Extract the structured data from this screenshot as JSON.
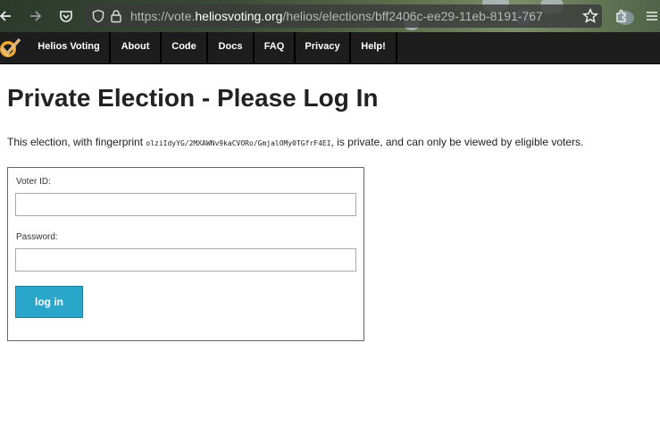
{
  "browser": {
    "url_scheme": "https://vote.",
    "url_domain": "heliosvoting.org",
    "url_path": "/helios/elections/bff2406c-ee29-11eb-8191-767"
  },
  "site_nav": {
    "items": [
      {
        "label": "Helios Voting"
      },
      {
        "label": "About"
      },
      {
        "label": "Code"
      },
      {
        "label": "Docs"
      },
      {
        "label": "FAQ"
      },
      {
        "label": "Privacy"
      },
      {
        "label": "Help!"
      }
    ]
  },
  "main": {
    "title": "Private Election - Please Log In",
    "intro_before": "This election, with fingerprint ",
    "fingerprint": "olziIdyYG/2MXAWNv9kaCVORo/GmjalOMy0TGfrF4EI",
    "intro_after": ", is private, and can only be viewed by eligible voters."
  },
  "login_form": {
    "voter_id_label": "Voter ID:",
    "voter_id_value": "",
    "password_label": "Password:",
    "password_value": "",
    "submit_label": "log in"
  },
  "colors": {
    "button": "#2ba6cb",
    "nav_background": "#1d1d1d"
  }
}
